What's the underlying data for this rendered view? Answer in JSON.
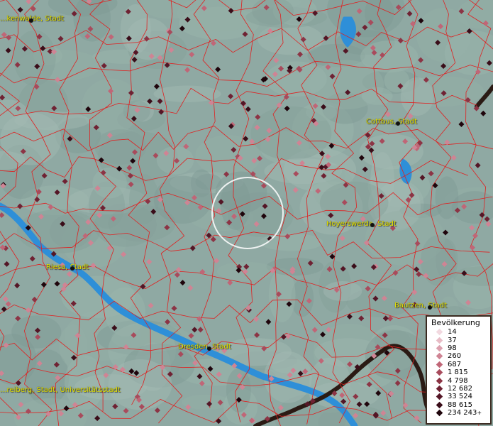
{
  "map": {
    "cities": [
      {
        "id": "kamenz-w",
        "label": "...kenwalde, Stadt"
      },
      {
        "id": "cottbus",
        "label": "Cottbus, Stadt"
      },
      {
        "id": "hoyerswerda",
        "label": "Hoyerswerda, Stadt"
      },
      {
        "id": "riesa",
        "label": "Riesa, Stadt"
      },
      {
        "id": "bautzen",
        "label": "Bautzen, Stadt"
      },
      {
        "id": "dresden",
        "label": "Dresden, Stadt"
      },
      {
        "id": "freiberg",
        "label": "...reiberg, Stadt, Universitätsstadt"
      }
    ],
    "colors": {
      "terrain": "#8fa9a3",
      "boundary": "#e02020",
      "water": "#2e8fd8",
      "border": "#2a1a14",
      "label": "#e6e600"
    }
  },
  "legend": {
    "title": "Bevölkerung",
    "items": [
      {
        "label": "14",
        "color": "#f2d9e0"
      },
      {
        "label": "37",
        "color": "#e8bcc6"
      },
      {
        "label": "98",
        "color": "#dca0ae"
      },
      {
        "label": "260",
        "color": "#cf8494"
      },
      {
        "label": "687",
        "color": "#c06677"
      },
      {
        "label": "1 815",
        "color": "#a84b5c"
      },
      {
        "label": "4 798",
        "color": "#8c3445"
      },
      {
        "label": "12 682",
        "color": "#6f2233"
      },
      {
        "label": "33 524",
        "color": "#541626"
      },
      {
        "label": "88 615",
        "color": "#3a0d19"
      },
      {
        "label": "234 243",
        "color": "#1f050c"
      }
    ],
    "overflow_mark": "+"
  }
}
